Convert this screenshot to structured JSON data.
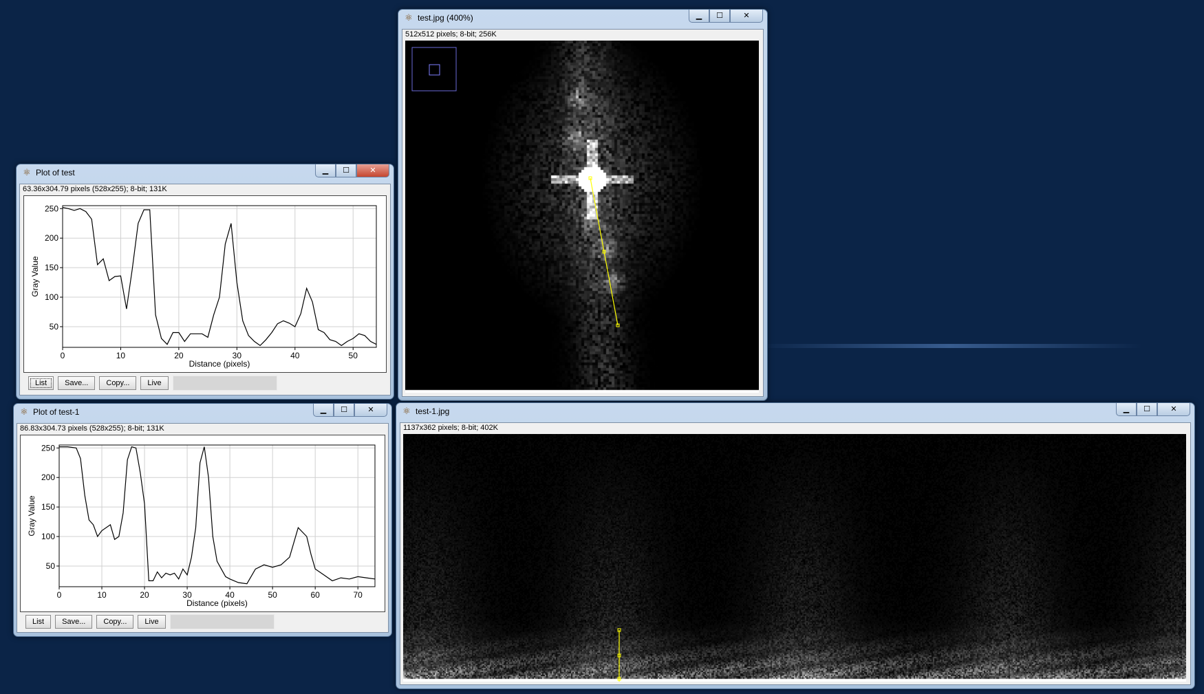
{
  "colors": {
    "desktop": "#0b2447",
    "line_roi": "#ffff00",
    "plot_line": "#000000"
  },
  "windows": {
    "plot1": {
      "title": "Plot of test",
      "info": "63.36x304.79 pixels (528x255); 8-bit; 131K",
      "controls": {
        "minimize": "▁",
        "maximize": "☐",
        "close": "✕"
      },
      "buttons": {
        "list": "List",
        "save": "Save...",
        "copy": "Copy...",
        "live": "Live"
      }
    },
    "plot2": {
      "title": "Plot of test-1",
      "info": "86.83x304.73 pixels (528x255); 8-bit; 131K",
      "controls": {
        "minimize": "▁",
        "maximize": "☐",
        "close": "✕"
      },
      "buttons": {
        "list": "List",
        "save": "Save...",
        "copy": "Copy...",
        "live": "Live"
      }
    },
    "image1": {
      "title": "test.jpg (400%)",
      "info": "512x512 pixels; 8-bit; 256K",
      "controls": {
        "minimize": "▁",
        "maximize": "☐",
        "close": "✕"
      },
      "icon": "microscope-icon"
    },
    "image2": {
      "title": "test-1.jpg",
      "info": "1137x362 pixels; 8-bit; 402K",
      "controls": {
        "minimize": "▁",
        "maximize": "☐",
        "close": "✕"
      },
      "icon": "microscope-icon"
    }
  },
  "chart_data": [
    {
      "type": "line",
      "xlabel": "Distance (pixels)",
      "ylabel": "Gray Value",
      "xlim": [
        0,
        54
      ],
      "ylim": [
        15,
        255
      ],
      "xticks": [
        0,
        10,
        20,
        30,
        40,
        50
      ],
      "yticks": [
        50,
        100,
        150,
        200,
        250
      ],
      "grid": true,
      "x": [
        0,
        1,
        2,
        3,
        4,
        5,
        6,
        7,
        8,
        9,
        10,
        11,
        12,
        13,
        14,
        15,
        16,
        17,
        18,
        19,
        20,
        21,
        22,
        23,
        24,
        25,
        26,
        27,
        28,
        29,
        30,
        31,
        32,
        33,
        34,
        35,
        36,
        37,
        38,
        39,
        40,
        41,
        42,
        43,
        44,
        45,
        46,
        47,
        48,
        49,
        50,
        51,
        52,
        53,
        54
      ],
      "y": [
        252,
        250,
        247,
        250,
        245,
        232,
        155,
        165,
        128,
        135,
        136,
        80,
        148,
        225,
        248,
        248,
        70,
        30,
        20,
        40,
        40,
        25,
        38,
        38,
        38,
        32,
        70,
        100,
        190,
        225,
        125,
        60,
        35,
        25,
        18,
        28,
        40,
        55,
        60,
        56,
        50,
        72,
        115,
        92,
        45,
        40,
        28,
        25,
        18,
        25,
        30,
        38,
        35,
        25,
        20
      ]
    },
    {
      "type": "line",
      "xlabel": "Distance (pixels)",
      "ylabel": "Gray Value",
      "xlim": [
        0,
        74
      ],
      "ylim": [
        15,
        255
      ],
      "xticks": [
        0,
        10,
        20,
        30,
        40,
        50,
        60,
        70
      ],
      "yticks": [
        50,
        100,
        150,
        200,
        250
      ],
      "grid": true,
      "x": [
        0,
        2,
        4,
        5,
        6,
        7,
        8,
        9,
        10,
        12,
        13,
        14,
        15,
        16,
        17,
        18,
        19,
        20,
        21,
        22,
        23,
        24,
        25,
        26,
        27,
        28,
        29,
        30,
        31,
        32,
        33,
        34,
        35,
        36,
        37,
        38,
        39,
        40,
        41,
        42,
        44,
        46,
        48,
        50,
        52,
        54,
        56,
        58,
        59,
        60,
        61,
        62,
        64,
        66,
        68,
        70,
        72,
        74
      ],
      "y": [
        252,
        252,
        250,
        232,
        170,
        128,
        120,
        100,
        110,
        120,
        95,
        100,
        140,
        230,
        252,
        250,
        208,
        155,
        25,
        25,
        40,
        30,
        38,
        35,
        38,
        28,
        45,
        35,
        65,
        115,
        225,
        252,
        200,
        100,
        58,
        45,
        32,
        28,
        25,
        22,
        20,
        45,
        52,
        48,
        52,
        65,
        115,
        100,
        70,
        45,
        40,
        35,
        25,
        30,
        28,
        32,
        30,
        28
      ]
    }
  ]
}
